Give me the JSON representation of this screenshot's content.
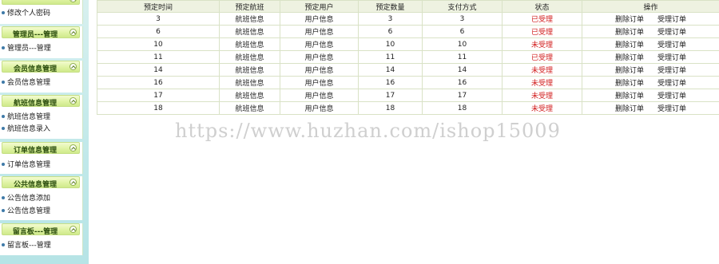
{
  "sidebar": {
    "top_item": "修改个人密码",
    "sections": [
      {
        "header": "管理员---管理",
        "items": [
          "管理员---管理"
        ]
      },
      {
        "header": "会员信息管理",
        "items": [
          "会员信息管理"
        ]
      },
      {
        "header": "航班信息管理",
        "items": [
          "航班信息管理",
          "航班信息录入"
        ]
      },
      {
        "header": "订单信息管理",
        "items": [
          "订单信息管理"
        ]
      },
      {
        "header": "公共信息管理",
        "items": [
          "公告信息添加",
          "公告信息管理"
        ]
      },
      {
        "header": "留言板---管理",
        "items": [
          "留言板---管理"
        ]
      }
    ]
  },
  "table": {
    "headers": [
      "预定时间",
      "预定航班",
      "预定用户",
      "预定数量",
      "支付方式",
      "状态",
      "操作"
    ],
    "actions": [
      "删除订单",
      "受理订单"
    ],
    "rows": [
      {
        "time": "3",
        "flight": "航班信息",
        "user": "用户信息",
        "qty": "3",
        "pay": "3",
        "status": "已受理"
      },
      {
        "time": "6",
        "flight": "航班信息",
        "user": "用户信息",
        "qty": "6",
        "pay": "6",
        "status": "已受理"
      },
      {
        "time": "10",
        "flight": "航班信息",
        "user": "用户信息",
        "qty": "10",
        "pay": "10",
        "status": "未受理"
      },
      {
        "time": "11",
        "flight": "航班信息",
        "user": "用户信息",
        "qty": "11",
        "pay": "11",
        "status": "已受理"
      },
      {
        "time": "14",
        "flight": "航班信息",
        "user": "用户信息",
        "qty": "14",
        "pay": "14",
        "status": "未受理"
      },
      {
        "time": "16",
        "flight": "航班信息",
        "user": "用户信息",
        "qty": "16",
        "pay": "16",
        "status": "未受理"
      },
      {
        "time": "17",
        "flight": "航班信息",
        "user": "用户信息",
        "qty": "17",
        "pay": "17",
        "status": "未受理"
      },
      {
        "time": "18",
        "flight": "航班信息",
        "user": "用户信息",
        "qty": "18",
        "pay": "18",
        "status": "未受理"
      }
    ]
  },
  "watermark": "https://www.huzhan.com/ishop15009",
  "colors": {
    "status_text": "#d11b1b",
    "header_bg": "#eef2e1",
    "sidebar_header_bg": "#dff3a4",
    "sidebar_bg": "#c2e9ea"
  }
}
